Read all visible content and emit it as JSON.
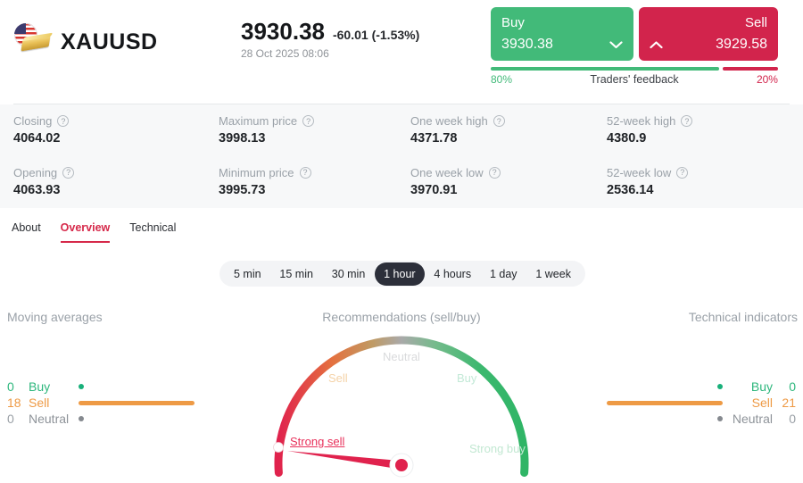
{
  "header": {
    "symbol": "XAUUSD",
    "price": "3930.38",
    "change": "-60.01 (-1.53%)",
    "datetime": "28 Oct 2025 08:06",
    "buy_button": {
      "label": "Buy",
      "price": "3930.38"
    },
    "sell_button": {
      "label": "Sell",
      "price": "3929.58"
    },
    "feedback": {
      "buy_pct": "80%",
      "label": "Traders' feedback",
      "sell_pct": "20%"
    }
  },
  "colors": {
    "buy_green": "#42ba79",
    "sell_red": "#d2244c",
    "orange": "#ee9a45",
    "list_green": "#2eb77d",
    "active_tab_red": "#d6294a",
    "active_pill_dark": "#2c2f3a"
  },
  "icons": {
    "help": "?"
  },
  "stats": [
    {
      "label": "Closing",
      "value": "4064.02"
    },
    {
      "label": "Maximum price",
      "value": "3998.13"
    },
    {
      "label": "One week high",
      "value": "4371.78"
    },
    {
      "label": "52-week high",
      "value": "4380.9"
    },
    {
      "label": "Opening",
      "value": "4063.93"
    },
    {
      "label": "Minimum price",
      "value": "3995.73"
    },
    {
      "label": "One week low",
      "value": "3970.91"
    },
    {
      "label": "52-week low",
      "value": "2536.14"
    }
  ],
  "tabs": [
    {
      "label": "About"
    },
    {
      "label": "Overview"
    },
    {
      "label": "Technical"
    }
  ],
  "active_tab": "Overview",
  "timeframes": [
    {
      "label": "5 min"
    },
    {
      "label": "15 min"
    },
    {
      "label": "30 min"
    },
    {
      "label": "1 hour"
    },
    {
      "label": "4 hours"
    },
    {
      "label": "1 day"
    },
    {
      "label": "1 week"
    }
  ],
  "active_timeframe": "1 hour",
  "panels": {
    "moving_averages": {
      "title": "Moving averages",
      "rows": [
        {
          "count": 0,
          "label": "Buy",
          "type": "buy"
        },
        {
          "count": 18,
          "label": "Sell",
          "type": "sell"
        },
        {
          "count": 0,
          "label": "Neutral",
          "type": "neutral"
        }
      ]
    },
    "recommendations": {
      "title": "Recommendations (sell/buy)",
      "verdict": "Strong sell",
      "labels": {
        "strong_sell": "Strong sell",
        "sell": "Sell",
        "neutral": "Neutral",
        "buy": "Buy",
        "strong_buy": "Strong buy"
      }
    },
    "technical_indicators": {
      "title": "Technical indicators",
      "rows": [
        {
          "count": 0,
          "label": "Buy",
          "type": "buy"
        },
        {
          "count": 21,
          "label": "Sell",
          "type": "sell"
        },
        {
          "count": 0,
          "label": "Neutral",
          "type": "neutral"
        }
      ]
    }
  }
}
